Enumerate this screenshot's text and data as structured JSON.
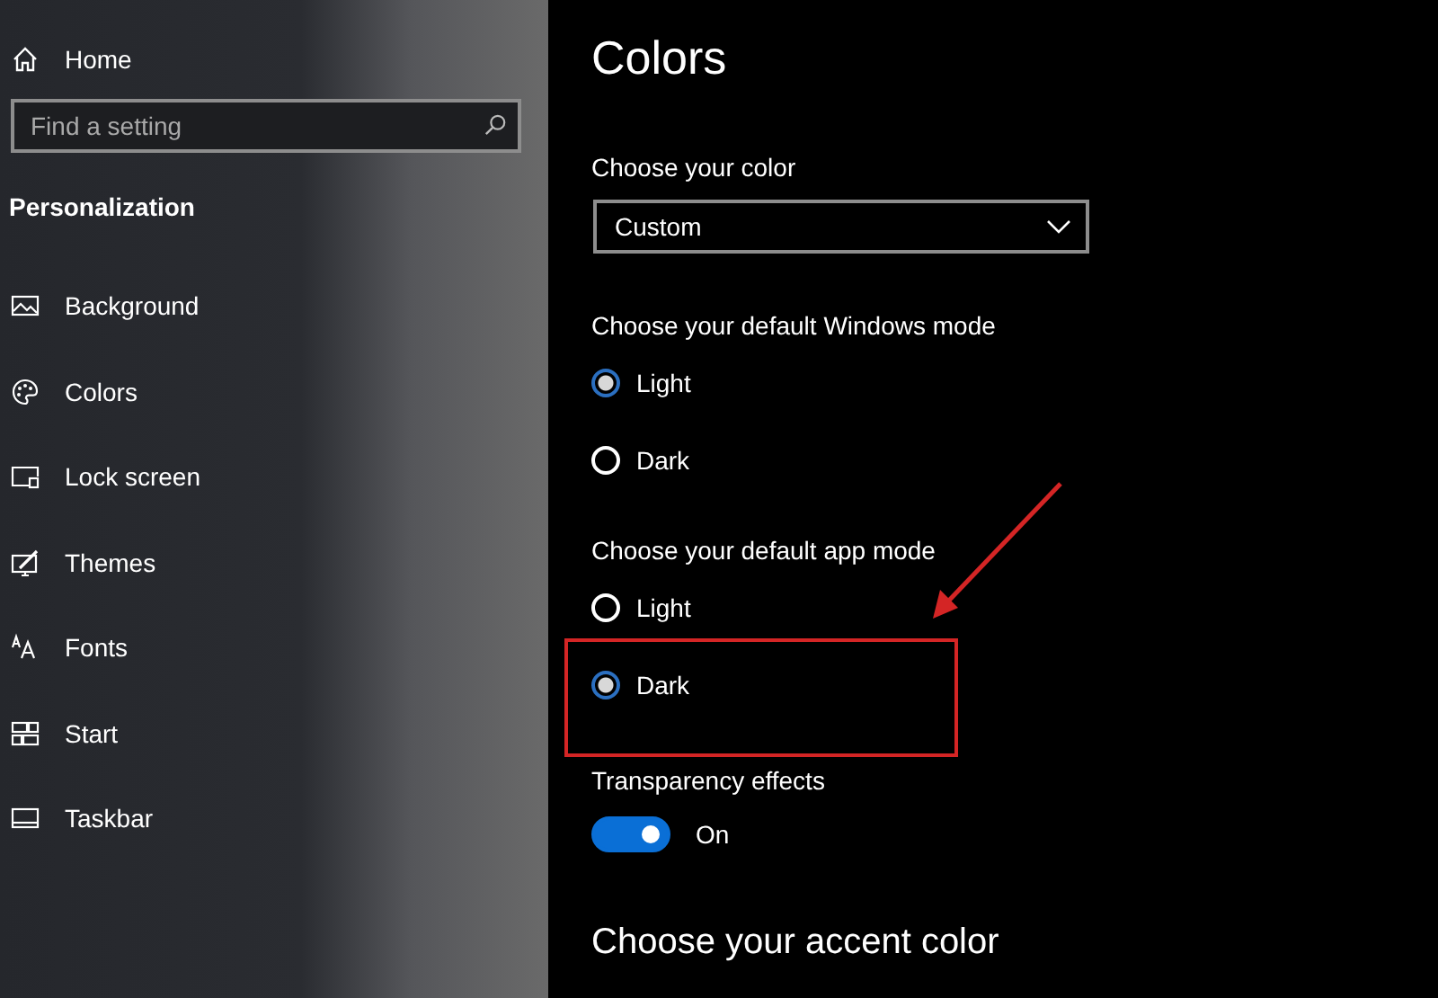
{
  "sidebar": {
    "home": "Home",
    "search": {
      "placeholder": "Find a setting"
    },
    "section": "Personalization",
    "items": [
      {
        "label": "Background"
      },
      {
        "label": "Colors"
      },
      {
        "label": "Lock screen"
      },
      {
        "label": "Themes"
      },
      {
        "label": "Fonts"
      },
      {
        "label": "Start"
      },
      {
        "label": "Taskbar"
      }
    ]
  },
  "page": {
    "title": "Colors",
    "color_label": "Choose your color",
    "color_value": "Custom",
    "groups": [
      {
        "label": "Choose your default Windows mode",
        "options": [
          {
            "label": "Light",
            "selected": true
          },
          {
            "label": "Dark",
            "selected": false
          }
        ]
      },
      {
        "label": "Choose your default app mode",
        "options": [
          {
            "label": "Light",
            "selected": false
          },
          {
            "label": "Dark",
            "selected": true
          }
        ]
      }
    ],
    "transparency": {
      "label": "Transparency effects",
      "on": true,
      "state": "On"
    },
    "accent_heading": "Choose your accent color"
  },
  "annotations": {
    "highlight_box": true,
    "arrow": true
  }
}
